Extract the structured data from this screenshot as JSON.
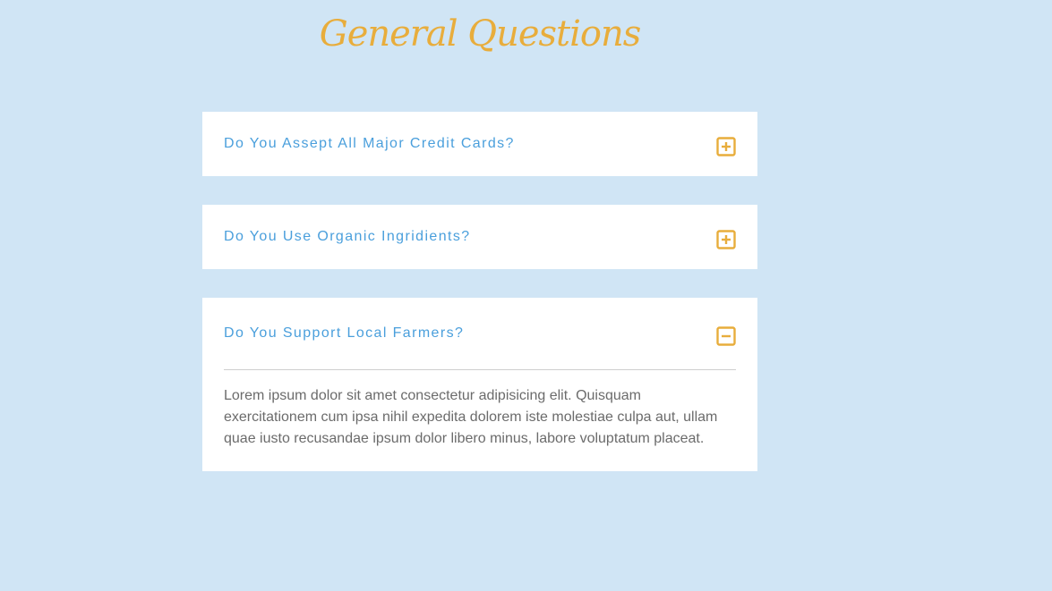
{
  "page": {
    "title": "General Questions"
  },
  "colors": {
    "background": "#d0e5f5",
    "accent": "#e8ad3c",
    "question_text": "#4a9fdc",
    "answer_text": "#6b6b6b"
  },
  "faq": {
    "items": [
      {
        "question": "Do You Assept All Major Credit Cards?",
        "state": "collapsed",
        "icon": "plus-square-icon"
      },
      {
        "question": "Do You Use Organic Ingridients?",
        "state": "collapsed",
        "icon": "plus-square-icon"
      },
      {
        "question": "Do You Support Local Farmers?",
        "state": "expanded",
        "icon": "minus-square-icon",
        "answer": "Lorem ipsum dolor sit amet consectetur adipisicing elit. Quisquam exercitationem cum ipsa nihil expedita dolorem iste molestiae culpa aut, ullam quae iusto recusandae ipsum dolor libero minus, labore voluptatum placeat."
      }
    ]
  }
}
